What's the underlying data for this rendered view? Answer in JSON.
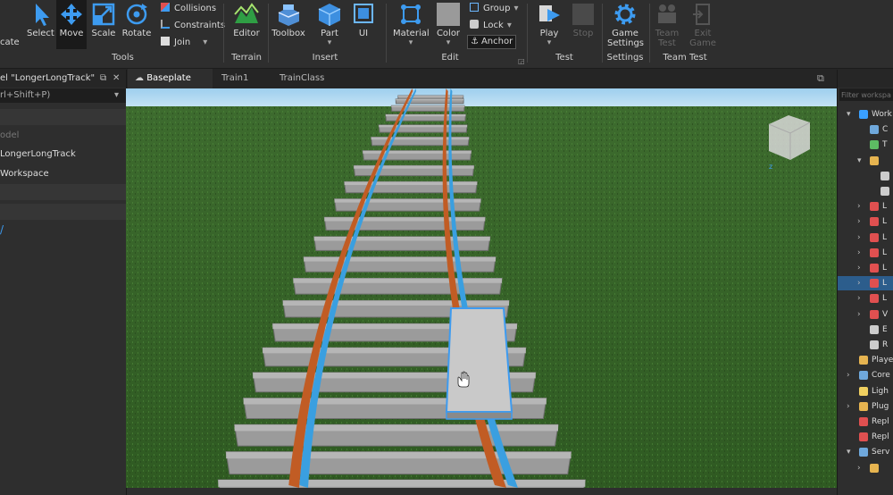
{
  "ribbon": {
    "home_partial": "cate",
    "tools": {
      "select": "Select",
      "move": "Move",
      "scale": "Scale",
      "rotate": "Rotate",
      "collisions": "Collisions",
      "constraints": "Constraints",
      "join": "Join",
      "group_label": "Tools"
    },
    "terrain": {
      "editor": "Editor",
      "group_label": "Terrain"
    },
    "insert": {
      "toolbox": "Toolbox",
      "part": "Part",
      "ui": "UI",
      "group_label": "Insert"
    },
    "edit": {
      "material": "Material",
      "color": "Color",
      "group": "Group",
      "lock": "Lock",
      "anchor": "Anchor",
      "group_label": "Edit"
    },
    "test": {
      "play": "Play",
      "stop": "Stop",
      "group_label": "Test"
    },
    "settings": {
      "game_settings_line1": "Game",
      "game_settings_line2": "Settings",
      "group_label": "Settings"
    },
    "team_test": {
      "team_test_line1": "Team",
      "team_test_line2": "Test",
      "exit_game_line1": "Exit",
      "exit_game_line2": "Game",
      "group_label": "Team Test"
    }
  },
  "tabs": [
    {
      "label": "Baseplate"
    },
    {
      "label": "Train1"
    },
    {
      "label": "TrainClass"
    }
  ],
  "left_panel": {
    "header": "el \"LongerLongTrack\"",
    "shortcut": "rl+Shift+P)",
    "item_model": "odel",
    "item_track": "LongerLongTrack",
    "item_workspace": "Workspace"
  },
  "explorer": {
    "filter_placeholder": "Filter workspa",
    "items": [
      {
        "label": "Work",
        "color": "#3aa0ff"
      },
      {
        "label": "C",
        "color": "#6fa8dc"
      },
      {
        "label": "T",
        "color": "#5dbb63"
      },
      {
        "label": "",
        "color": "#e6b450"
      },
      {
        "label": "",
        "color": "#cccccc"
      },
      {
        "label": "",
        "color": "#cccccc"
      },
      {
        "label": "L",
        "color": "#e05050"
      },
      {
        "label": "L",
        "color": "#e05050"
      },
      {
        "label": "L",
        "color": "#e05050"
      },
      {
        "label": "L",
        "color": "#e05050"
      },
      {
        "label": "L",
        "color": "#e05050"
      },
      {
        "label": "L",
        "color": "#e05050"
      },
      {
        "label": "L",
        "color": "#e05050"
      },
      {
        "label": "V",
        "color": "#e05050"
      },
      {
        "label": "E",
        "color": "#cccccc"
      },
      {
        "label": "R",
        "color": "#cccccc"
      },
      {
        "label": "Playe",
        "color": "#e6b450"
      },
      {
        "label": "Core",
        "color": "#6fa8dc"
      },
      {
        "label": "Ligh",
        "color": "#f0d060"
      },
      {
        "label": "Plug",
        "color": "#e6b450"
      },
      {
        "label": "Repl",
        "color": "#e05050"
      },
      {
        "label": "Repl",
        "color": "#e05050"
      },
      {
        "label": "Serv",
        "color": "#6fa8dc"
      },
      {
        "label": "",
        "color": "#e6b450"
      }
    ]
  }
}
